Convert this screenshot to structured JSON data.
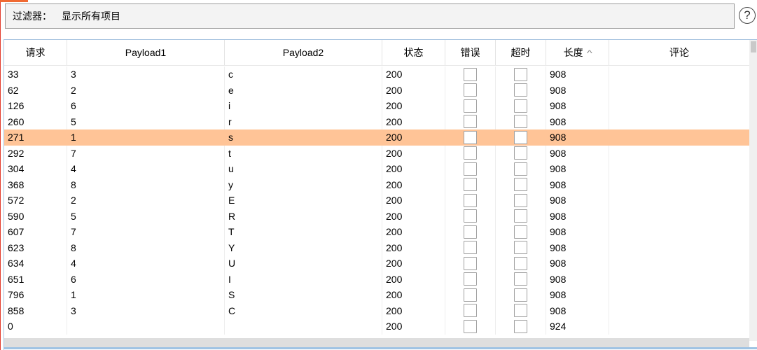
{
  "filter": {
    "label": "过滤器：",
    "value": "显示所有项目"
  },
  "help": {
    "symbol": "?"
  },
  "columns": {
    "request": "请求",
    "payload1": "Payload1",
    "payload2": "Payload2",
    "status": "状态",
    "error": "错误",
    "timeout": "超时",
    "length": "长度",
    "comment": "评论"
  },
  "sort": {
    "column": "length",
    "direction": "ascending",
    "icon": "chevron-up-icon"
  },
  "colors": {
    "selected_row": "#ffc497",
    "table_border": "#a8c4e0"
  },
  "rows": [
    {
      "request": "33",
      "payload1": "3",
      "payload2": "c",
      "status": "200",
      "length": "908",
      "comment": "",
      "selected": false
    },
    {
      "request": "62",
      "payload1": "2",
      "payload2": "e",
      "status": "200",
      "length": "908",
      "comment": "",
      "selected": false
    },
    {
      "request": "126",
      "payload1": "6",
      "payload2": "i",
      "status": "200",
      "length": "908",
      "comment": "",
      "selected": false
    },
    {
      "request": "260",
      "payload1": "5",
      "payload2": "r",
      "status": "200",
      "length": "908",
      "comment": "",
      "selected": false
    },
    {
      "request": "271",
      "payload1": "1",
      "payload2": "s",
      "status": "200",
      "length": "908",
      "comment": "",
      "selected": true
    },
    {
      "request": "292",
      "payload1": "7",
      "payload2": "t",
      "status": "200",
      "length": "908",
      "comment": "",
      "selected": false
    },
    {
      "request": "304",
      "payload1": "4",
      "payload2": "u",
      "status": "200",
      "length": "908",
      "comment": "",
      "selected": false
    },
    {
      "request": "368",
      "payload1": "8",
      "payload2": "y",
      "status": "200",
      "length": "908",
      "comment": "",
      "selected": false
    },
    {
      "request": "572",
      "payload1": "2",
      "payload2": "E",
      "status": "200",
      "length": "908",
      "comment": "",
      "selected": false
    },
    {
      "request": "590",
      "payload1": "5",
      "payload2": "R",
      "status": "200",
      "length": "908",
      "comment": "",
      "selected": false
    },
    {
      "request": "607",
      "payload1": "7",
      "payload2": "T",
      "status": "200",
      "length": "908",
      "comment": "",
      "selected": false
    },
    {
      "request": "623",
      "payload1": "8",
      "payload2": "Y",
      "status": "200",
      "length": "908",
      "comment": "",
      "selected": false
    },
    {
      "request": "634",
      "payload1": "4",
      "payload2": "U",
      "status": "200",
      "length": "908",
      "comment": "",
      "selected": false
    },
    {
      "request": "651",
      "payload1": "6",
      "payload2": "I",
      "status": "200",
      "length": "908",
      "comment": "",
      "selected": false
    },
    {
      "request": "796",
      "payload1": "1",
      "payload2": "S",
      "status": "200",
      "length": "908",
      "comment": "",
      "selected": false
    },
    {
      "request": "858",
      "payload1": "3",
      "payload2": "C",
      "status": "200",
      "length": "908",
      "comment": "",
      "selected": false
    },
    {
      "request": "0",
      "payload1": "",
      "payload2": "",
      "status": "200",
      "length": "924",
      "comment": "",
      "selected": false
    }
  ]
}
